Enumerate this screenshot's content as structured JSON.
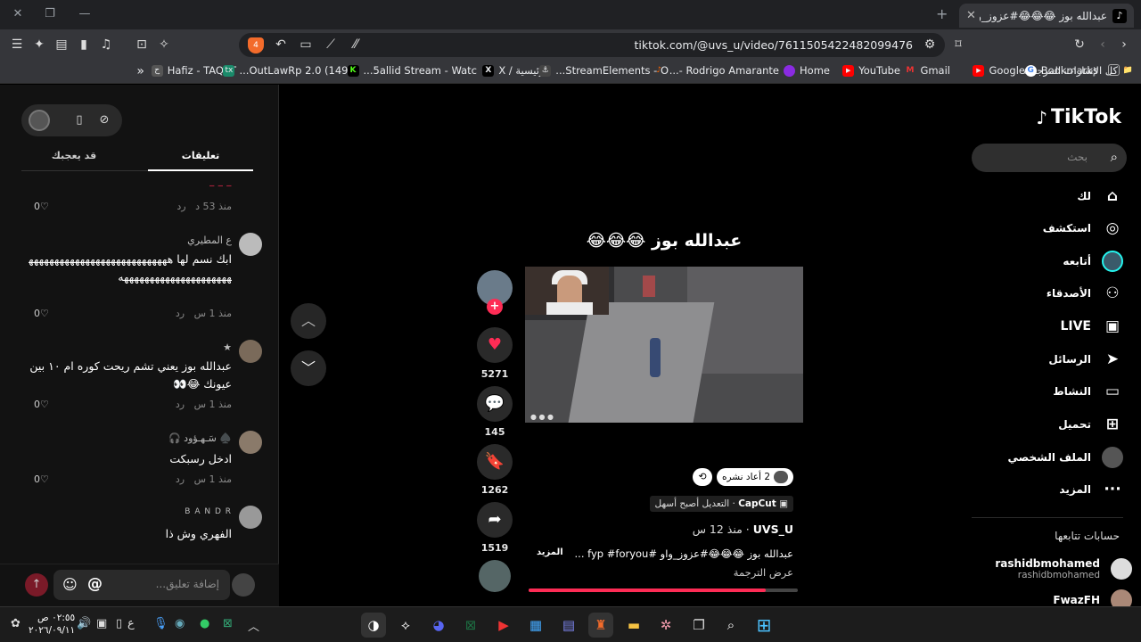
{
  "browser": {
    "tab_title": "عبدالله بوز 😂😂😂#عزوز_واو #ل",
    "url": "tiktok.com/@uvs_u/video/7611505422482099476",
    "brave_badge": "4",
    "bookmarks": [
      {
        "label": "كل الإشارات المرجعية",
        "fav": "📁",
        "color": "#35363a"
      },
      {
        "label": "Hafiz - TAQAT",
        "fav": "ح",
        "color": "#444"
      },
      {
        "label": "(149) OutLawRp 2.0...",
        "fav": "▤",
        "color": "#4a5a8a"
      },
      {
        "label": "5allid Stream - Watc...",
        "fav": "tx",
        "color": "#1a6"
      },
      {
        "label": "الرئيسية / X",
        "fav": "K",
        "color": "#53fc18"
      },
      {
        "label": "StreamElements - O...",
        "fav": "X",
        "color": "#000"
      },
      {
        "label": "Rodrigo Amarante -...",
        "fav": "⚓",
        "color": "#35363a"
      },
      {
        "label": "Home",
        "fav": "♪",
        "color": "#f60"
      },
      {
        "label": "YouTube",
        "fav": "◐",
        "color": "#8a2be2"
      },
      {
        "label": "Gmail",
        "fav": "▶",
        "color": "#f00"
      },
      {
        "label": "Google",
        "fav": "M",
        "color": "#d33"
      },
      {
        "label": "Bookmarks",
        "fav": "▶",
        "color": "#f00"
      },
      {
        "label": "",
        "fav": "G",
        "color": "#fff"
      }
    ]
  },
  "nav": {
    "logo": "TikTok",
    "search_placeholder": "بحث",
    "items": [
      {
        "label": "لك",
        "icon": "⌂"
      },
      {
        "label": "استكشف",
        "icon": "◎"
      },
      {
        "label": "أتابعه",
        "icon": "avatar"
      },
      {
        "label": "الأصدقاء",
        "icon": "👥"
      },
      {
        "label": "LIVE",
        "icon": "▣"
      },
      {
        "label": "الرسائل",
        "icon": "➤"
      },
      {
        "label": "النشاط",
        "icon": "▭"
      },
      {
        "label": "تحميل",
        "icon": "⊞"
      },
      {
        "label": "الملف الشخصي",
        "icon": "avatar-small"
      },
      {
        "label": "المزيد",
        "icon": "···"
      }
    ],
    "following_title": "حسابات تتابعها",
    "following": [
      {
        "name": "rashidbmohamed",
        "handle": "rashidbmohamed"
      },
      {
        "name": "FwazFH",
        "handle": ""
      }
    ]
  },
  "video": {
    "title": "عبدالله بوز 😂😂😂",
    "likes": "5271",
    "comments": "145",
    "saves": "1262",
    "shares": "1519",
    "repost_text": "2 أعاد نشره",
    "capcut_brand": "CapCut",
    "capcut_text": "· التعديل أصبح أسهل",
    "author": "UVS_U",
    "time": "· منذ 12 س",
    "description": "عبدالله بوز 😂😂😂#عزوز_واو #fyp #foryou ...",
    "more": "المزيد",
    "translate": "عرض الترجمة",
    "progress": 0.88
  },
  "comments_panel": {
    "tabs": [
      "قد يعجبك",
      "تعليقات"
    ],
    "reply": "رد",
    "input_placeholder": "إضافة تعليق...",
    "comments": [
      {
        "name": "",
        "text": "",
        "time": "منذ 53 د",
        "likes": "0"
      },
      {
        "name": "ع  المطيري",
        "text": "ابك نسم لها هههههههههههههههههههههههههههههههههههههههههههههههههه",
        "time": "منذ 1 س",
        "likes": "0"
      },
      {
        "name": "★",
        "text": "عبدالله بوز يعني تشم ريحت كوره ام ١٠ بين عيونك 😂👀",
        "time": "منذ 1 س",
        "likes": "0"
      },
      {
        "name": "♠️ سَـهـؤود 🎧",
        "text": "ادخل رسبكت",
        "time": "منذ 1 س",
        "likes": "0"
      },
      {
        "name": "B A N D R",
        "text": "الفهري وش ذا",
        "time": "",
        "likes": ""
      }
    ]
  },
  "taskbar": {
    "time": "٠٢:٥٥ ص",
    "date": "٢٠٢٦/٠٩/١١",
    "lang": "ع"
  }
}
